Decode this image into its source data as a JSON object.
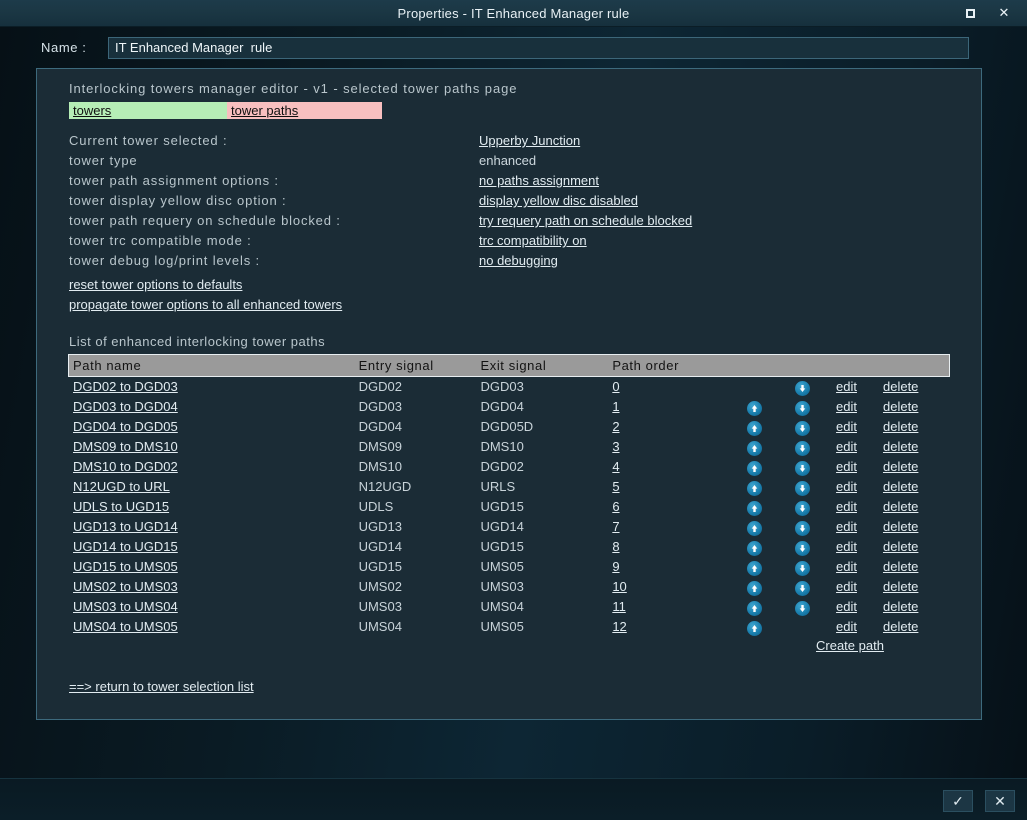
{
  "window": {
    "title": "Properties - IT Enhanced Manager rule",
    "maximize_label": "maximize",
    "close_label": "✕"
  },
  "name_field": {
    "label": "Name :",
    "value": "IT Enhanced Manager  rule",
    "placeholder": "Name"
  },
  "editor": {
    "heading": "Interlocking  towers  manager  editor  -  v1  -  selected  tower  paths  page",
    "tabs": [
      {
        "label": "towers",
        "color": "#b6eeb6",
        "active": false
      },
      {
        "label": "tower paths",
        "color": "#f8bfbf",
        "active": true
      }
    ],
    "info_rows": [
      {
        "label": "Current  tower  selected  :",
        "value": "Upperby Junction",
        "link": true
      },
      {
        "label": "tower  type",
        "value": "enhanced",
        "link": false
      },
      {
        "label": "tower  path  assignment  options  :",
        "value": "no paths assignment",
        "link": true
      },
      {
        "label": "tower  display  yellow  disc  option  :",
        "value": "display yellow disc disabled",
        "link": true
      },
      {
        "label": "tower  path  requery  on  schedule  blocked  :",
        "value": "try requery path on schedule blocked",
        "link": true
      },
      {
        "label": "tower  trc  compatible  mode  :",
        "value": "trc compatibility on",
        "link": true
      },
      {
        "label": "tower  debug  log/print  levels  :",
        "value": "no debugging",
        "link": true
      }
    ],
    "actions": [
      "reset tower options to defaults",
      "propagate tower options to all enhanced towers"
    ],
    "list_title": "List of enhanced interlocking tower paths",
    "return_link": "==> return to tower selection list",
    "create_link": "Create path"
  },
  "table": {
    "columns": [
      "Path name",
      "Entry  signal",
      "Exit  signal",
      "Path  order"
    ],
    "edit_label": "edit",
    "delete_label": "delete",
    "up_icon": "arrow-up-icon",
    "down_icon": "arrow-down-icon",
    "rows": [
      {
        "name": "DGD02 to DGD03",
        "entry": "DGD02",
        "exit": "DGD03",
        "order": "0",
        "up": false,
        "down": true
      },
      {
        "name": "DGD03 to DGD04",
        "entry": "DGD03",
        "exit": "DGD04",
        "order": "1",
        "up": true,
        "down": true
      },
      {
        "name": "DGD04 to DGD05",
        "entry": "DGD04",
        "exit": "DGD05D",
        "order": "2",
        "up": true,
        "down": true
      },
      {
        "name": "DMS09 to DMS10",
        "entry": "DMS09",
        "exit": "DMS10",
        "order": "3",
        "up": true,
        "down": true
      },
      {
        "name": "DMS10 to DGD02",
        "entry": "DMS10",
        "exit": "DGD02",
        "order": "4",
        "up": true,
        "down": true
      },
      {
        "name": "N12UGD to URL",
        "entry": "N12UGD",
        "exit": "URLS",
        "order": "5",
        "up": true,
        "down": true
      },
      {
        "name": "UDLS to UGD15",
        "entry": "UDLS",
        "exit": "UGD15",
        "order": "6",
        "up": true,
        "down": true
      },
      {
        "name": "UGD13 to UGD14",
        "entry": "UGD13",
        "exit": "UGD14",
        "order": "7",
        "up": true,
        "down": true
      },
      {
        "name": "UGD14 to UGD15",
        "entry": "UGD14",
        "exit": "UGD15",
        "order": "8",
        "up": true,
        "down": true
      },
      {
        "name": "UGD15 to UMS05",
        "entry": "UGD15",
        "exit": "UMS05",
        "order": "9",
        "up": true,
        "down": true
      },
      {
        "name": "UMS02 to UMS03",
        "entry": "UMS02",
        "exit": "UMS03",
        "order": "10",
        "up": true,
        "down": true
      },
      {
        "name": "UMS03 to UMS04",
        "entry": "UMS03",
        "exit": "UMS04",
        "order": "11",
        "up": true,
        "down": true
      },
      {
        "name": "UMS04 to UMS05",
        "entry": "UMS04",
        "exit": "UMS05",
        "order": "12",
        "up": true,
        "down": false
      }
    ]
  },
  "footer": {
    "accept_label": "✓",
    "cancel_label": "✕"
  },
  "colors": {
    "panel_bg": "#1b2c36",
    "panel_border": "#3d6a7d",
    "titlebar": "#1b3744",
    "tab_green": "#b6eeb6",
    "tab_pink": "#f8bfbf",
    "table_header": "#9a9a9a",
    "arrow_blue": "#1a7fae"
  }
}
